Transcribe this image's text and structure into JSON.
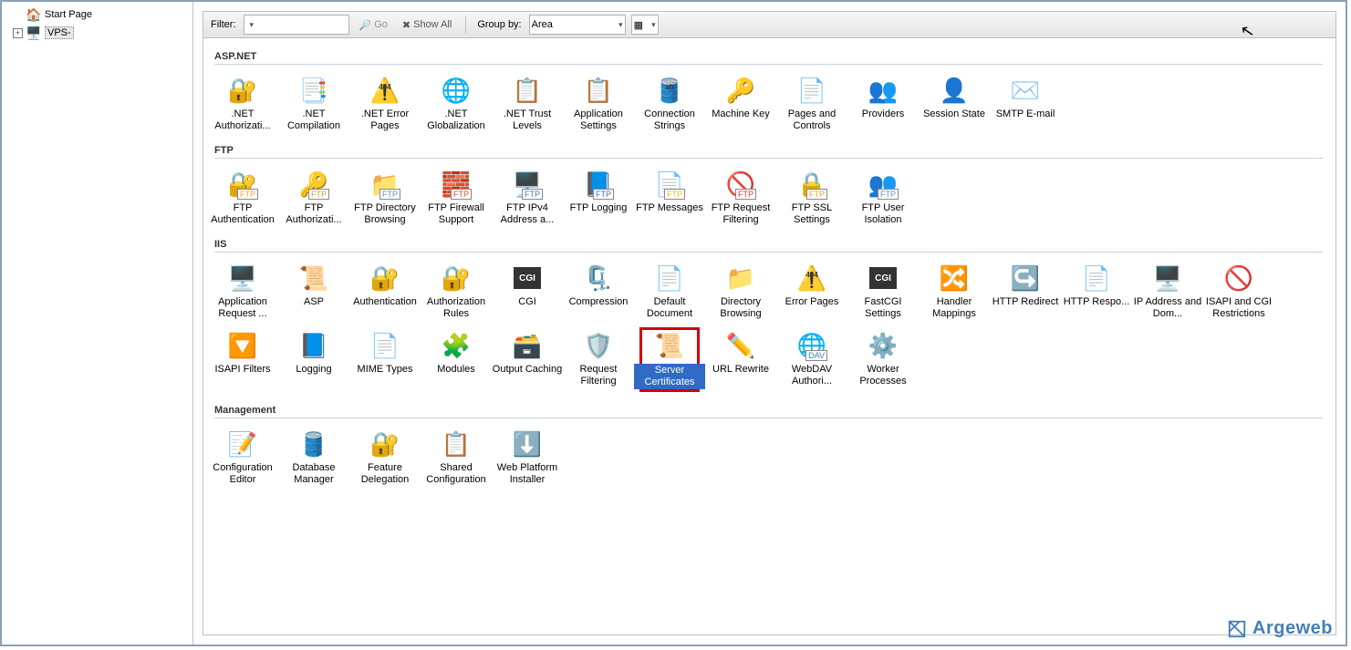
{
  "tree": {
    "start_page": "Start Page",
    "server_name": "VPS-"
  },
  "toolbar": {
    "filter_label": "Filter:",
    "go_label": "Go",
    "show_all_label": "Show All",
    "group_by_label": "Group by:",
    "group_by_value": "Area"
  },
  "groups": [
    {
      "name": "ASP.NET",
      "items": [
        {
          "label": ".NET Authorizati...",
          "icon": "🔐",
          "color": "#e2a835"
        },
        {
          "label": ".NET Compilation",
          "icon": "📑",
          "color": "#6a8fb8"
        },
        {
          "label": ".NET Error Pages",
          "icon": "⚠️",
          "color": "#e2c235",
          "sub": "404"
        },
        {
          "label": ".NET Globalization",
          "icon": "🌐",
          "color": "#3a86c8"
        },
        {
          "label": ".NET Trust Levels",
          "icon": "📋",
          "color": "#3a9a3a",
          "check": true
        },
        {
          "label": "Application Settings",
          "icon": "📋",
          "color": "#4a72b0"
        },
        {
          "label": "Connection Strings",
          "icon": "🛢️",
          "color": "#d88a3a",
          "sub": "ab"
        },
        {
          "label": "Machine Key",
          "icon": "🔑",
          "color": "#c8a23a"
        },
        {
          "label": "Pages and Controls",
          "icon": "📄",
          "color": "#6a8fb8"
        },
        {
          "label": "Providers",
          "icon": "👥",
          "color": "#d88a3a"
        },
        {
          "label": "Session State",
          "icon": "👤",
          "color": "#d88a3a"
        },
        {
          "label": "SMTP E-mail",
          "icon": "✉️",
          "color": "#6a8fb8"
        }
      ]
    },
    {
      "name": "FTP",
      "items": [
        {
          "label": "FTP Authentication",
          "icon": "🔐",
          "color": "#e2a835",
          "badge": "FTP"
        },
        {
          "label": "FTP Authorizati...",
          "icon": "🔑",
          "color": "#c8a23a",
          "badge": "FTP"
        },
        {
          "label": "FTP Directory Browsing",
          "icon": "📁",
          "color": "#6a8fb8",
          "badge": "FTP"
        },
        {
          "label": "FTP Firewall Support",
          "icon": "🧱",
          "color": "#c8503a",
          "badge": "FTP"
        },
        {
          "label": "FTP IPv4 Address a...",
          "icon": "🖥️",
          "color": "#4a72b0",
          "badge": "FTP"
        },
        {
          "label": "FTP Logging",
          "icon": "📘",
          "color": "#4a72b0",
          "badge": "FTP"
        },
        {
          "label": "FTP Messages",
          "icon": "📄",
          "color": "#d8c23a",
          "badge": "FTP"
        },
        {
          "label": "FTP Request Filtering",
          "icon": "🚫",
          "color": "#c83a3a",
          "badge": "FTP"
        },
        {
          "label": "FTP SSL Settings",
          "icon": "🔒",
          "color": "#e2a835",
          "badge": "FTP"
        },
        {
          "label": "FTP User Isolation",
          "icon": "👥",
          "color": "#6a8fb8",
          "badge": "FTP"
        }
      ]
    },
    {
      "name": "IIS",
      "items": [
        {
          "label": "Application Request ...",
          "icon": "🖥️",
          "color": "#4a72b0"
        },
        {
          "label": "ASP",
          "icon": "📜",
          "color": "#d88a3a"
        },
        {
          "label": "Authentication",
          "icon": "🔐",
          "color": "#e2a835"
        },
        {
          "label": "Authorization Rules",
          "icon": "🔐",
          "color": "#e2a835"
        },
        {
          "label": "CGI",
          "icon": "◼",
          "color": "#404040",
          "text": "CGI"
        },
        {
          "label": "Compression",
          "icon": "🗜️",
          "color": "#6a8fb8"
        },
        {
          "label": "Default Document",
          "icon": "📄",
          "color": "#6a8fb8"
        },
        {
          "label": "Directory Browsing",
          "icon": "📁",
          "color": "#6a8fb8"
        },
        {
          "label": "Error Pages",
          "icon": "⚠️",
          "color": "#e2c235",
          "sub": "404"
        },
        {
          "label": "FastCGI Settings",
          "icon": "⚙️",
          "color": "#3a9a3a",
          "text": "CGI"
        },
        {
          "label": "Handler Mappings",
          "icon": "🔀",
          "color": "#3a86c8"
        },
        {
          "label": "HTTP Redirect",
          "icon": "↪️",
          "color": "#3a86c8"
        },
        {
          "label": "HTTP Respo...",
          "icon": "📄",
          "color": "#6a8fb8"
        },
        {
          "label": "IP Address and Dom...",
          "icon": "🖥️",
          "color": "#4a72b0"
        },
        {
          "label": "ISAPI and CGI Restrictions",
          "icon": "🚫",
          "color": "#404040"
        },
        {
          "label": "ISAPI Filters",
          "icon": "🔽",
          "color": "#4a72b0"
        },
        {
          "label": "Logging",
          "icon": "📘",
          "color": "#4a72b0"
        },
        {
          "label": "MIME Types",
          "icon": "📄",
          "color": "#6a8fb8"
        },
        {
          "label": "Modules",
          "icon": "🧩",
          "color": "#3a9a3a"
        },
        {
          "label": "Output Caching",
          "icon": "🗃️",
          "color": "#6a8fb8"
        },
        {
          "label": "Request Filtering",
          "icon": "🛡️",
          "color": "#3a9a3a"
        },
        {
          "label": "Server Certificates",
          "icon": "📜",
          "color": "#6a8fb8",
          "selected": true
        },
        {
          "label": "URL Rewrite",
          "icon": "✏️",
          "color": "#d88a3a"
        },
        {
          "label": "WebDAV Authori...",
          "icon": "🌐",
          "color": "#3a86c8",
          "badge": "DAV"
        },
        {
          "label": "Worker Processes",
          "icon": "⚙️",
          "color": "#d88a3a"
        }
      ]
    },
    {
      "name": "Management",
      "items": [
        {
          "label": "Configuration Editor",
          "icon": "📝",
          "color": "#6a8fb8"
        },
        {
          "label": "Database Manager",
          "icon": "🛢️",
          "color": "#6a8fb8"
        },
        {
          "label": "Feature Delegation",
          "icon": "🔐",
          "color": "#6a8fb8"
        },
        {
          "label": "Shared Configuration",
          "icon": "📋",
          "color": "#4a72b0"
        },
        {
          "label": "Web Platform Installer",
          "icon": "⬇️",
          "color": "#d88a3a"
        }
      ]
    }
  ],
  "watermark": "Argeweb"
}
